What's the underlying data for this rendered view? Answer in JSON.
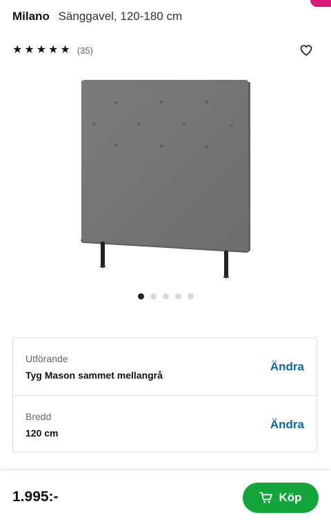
{
  "header": {
    "brand": "Milano",
    "description": "Sänggavel, 120-180 cm"
  },
  "rating": {
    "stars": 5,
    "max_stars": 5,
    "review_count": "(35)"
  },
  "gallery": {
    "image_icon": "upholstered-headboard-image",
    "total_slides": 5,
    "active_slide": 1
  },
  "options": [
    {
      "label": "Utförande",
      "value": "Tyg Mason sammet mellangrå",
      "action": "Ändra"
    },
    {
      "label": "Bredd",
      "value": "120 cm",
      "action": "Ändra"
    }
  ],
  "purchase": {
    "price": "1.995:-",
    "buy_label": "Köp",
    "buy_icon": "cart-icon"
  },
  "colors": {
    "accent_blue": "#0a6aa9",
    "buy_green": "#13a43a",
    "badge_pink": "#d81b78"
  }
}
